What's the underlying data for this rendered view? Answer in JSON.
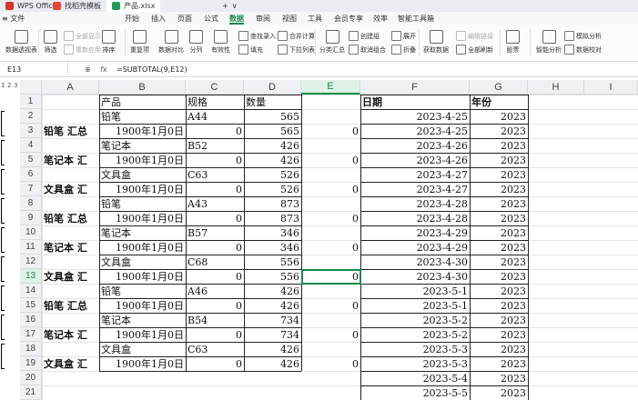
{
  "titlebar": {
    "tabs": [
      {
        "label": "WPS Office",
        "color": "#d8322b"
      },
      {
        "label": "找稻壳模板",
        "color": "#e8453c"
      },
      {
        "label": "产品.xlsx",
        "color": "#1f9d55"
      }
    ],
    "add": "+",
    "more": "∨"
  },
  "menubar": {
    "items": [
      "≡ 文件",
      "开始",
      "插入",
      "页面",
      "公式",
      "数据",
      "审阅",
      "视图",
      "工具",
      "会员专享",
      "效率",
      "智能工具箱"
    ],
    "active": "数据"
  },
  "toolbar": {
    "pivot": "数据透视表",
    "filter": "筛选",
    "show_all": "全部显示",
    "reapply": "重新应用",
    "sort": "排序",
    "duplicates": "重复项",
    "compare": "数据对比",
    "split": "分列",
    "validity": "有效性",
    "find_input": "查找录入",
    "fill": "填充",
    "merge_calc": "合并计算",
    "dropdown_list": "下拉列表",
    "subtotal": "分类汇总",
    "create_group": "创建组",
    "ungroup": "取消组合",
    "expand": "展开",
    "collapse": "折叠",
    "get_data": "获取数据",
    "edit_links": "编辑链接",
    "refresh_all": "全部刷新",
    "stocks": "股票",
    "smart_analysis": "智能分析",
    "simulate": "模拟分析",
    "verify": "数据校对"
  },
  "formulabar": {
    "cell_ref": "E13",
    "fx": "fx",
    "formula": "=SUBTOTAL(9,E12)"
  },
  "outline_levels": [
    "1",
    "2",
    "3"
  ],
  "columns": [
    "A",
    "B",
    "C",
    "D",
    "E",
    "F",
    "G",
    "H",
    "I"
  ],
  "active_column": "E",
  "rows": [
    "1",
    "2",
    "3",
    "4",
    "5",
    "6",
    "7",
    "8",
    "9",
    "10",
    "11",
    "12",
    "13",
    "14",
    "15",
    "16",
    "17",
    "18",
    "19",
    "20",
    "21"
  ],
  "active_row": "13",
  "headers": {
    "product": "产品",
    "spec": "规格",
    "qty": "数量",
    "date": "日期",
    "year": "年份"
  },
  "detail_rows": [
    {
      "row": 2,
      "product": "铅笔",
      "spec": "A44",
      "qty": "565"
    },
    {
      "row": 4,
      "product": "笔记本",
      "spec": "B52",
      "qty": "426"
    },
    {
      "row": 6,
      "product": "文具盒",
      "spec": "C63",
      "qty": "526"
    },
    {
      "row": 8,
      "product": "铅笔",
      "spec": "A43",
      "qty": "873"
    },
    {
      "row": 10,
      "product": "笔记本",
      "spec": "B57",
      "qty": "346"
    },
    {
      "row": 12,
      "product": "文具盒",
      "spec": "C68",
      "qty": "556"
    },
    {
      "row": 14,
      "product": "铅笔",
      "spec": "A46",
      "qty": "426"
    },
    {
      "row": 16,
      "product": "笔记本",
      "spec": "B54",
      "qty": "734"
    },
    {
      "row": 18,
      "product": "文具盒",
      "spec": "C63",
      "qty": "426"
    }
  ],
  "total_rows": [
    {
      "row": 3,
      "label": "铅笔 汇总",
      "date_b": "1900年1月0日",
      "c": "0",
      "qty": "565",
      "e": "0"
    },
    {
      "row": 5,
      "label": "笔记本 汇",
      "date_b": "1900年1月0日",
      "c": "0",
      "qty": "426",
      "e": "0"
    },
    {
      "row": 7,
      "label": "文具盒 汇",
      "date_b": "1900年1月0日",
      "c": "0",
      "qty": "526",
      "e": "0"
    },
    {
      "row": 9,
      "label": "铅笔 汇总",
      "date_b": "1900年1月0日",
      "c": "0",
      "qty": "873",
      "e": "0"
    },
    {
      "row": 11,
      "label": "笔记本 汇",
      "date_b": "1900年1月0日",
      "c": "0",
      "qty": "346",
      "e": "0"
    },
    {
      "row": 13,
      "label": "文具盒 汇",
      "date_b": "1900年1月0日",
      "c": "0",
      "qty": "556",
      "e": "0"
    },
    {
      "row": 15,
      "label": "铅笔 汇总",
      "date_b": "1900年1月0日",
      "c": "0",
      "qty": "426",
      "e": "0"
    },
    {
      "row": 17,
      "label": "笔记本 汇",
      "date_b": "1900年1月0日",
      "c": "0",
      "qty": "734",
      "e": "0"
    },
    {
      "row": 19,
      "label": "文具盒 汇",
      "date_b": "1900年1月0日",
      "c": "0",
      "qty": "426",
      "e": "0"
    }
  ],
  "dates": [
    "2023-4-25",
    "2023-4-25",
    "2023-4-26",
    "2023-4-26",
    "2023-4-27",
    "2023-4-27",
    "2023-4-28",
    "2023-4-28",
    "2023-4-29",
    "2023-4-29",
    "2023-4-30",
    "2023-4-30",
    "2023-5-1",
    "2023-5-1",
    "2023-5-2",
    "2023-5-2",
    "2023-5-3",
    "2023-5-3",
    "2023-5-4",
    "2023-5-5"
  ],
  "years": [
    "2023",
    "2023",
    "2023",
    "2023",
    "2023",
    "2023",
    "2023",
    "2023",
    "2023",
    "2023",
    "2023",
    "2023",
    "2023",
    "2023",
    "2023",
    "2023",
    "2023",
    "2023",
    "2023",
    "2023"
  ],
  "colors": {
    "accent": "#1a8a4a"
  }
}
